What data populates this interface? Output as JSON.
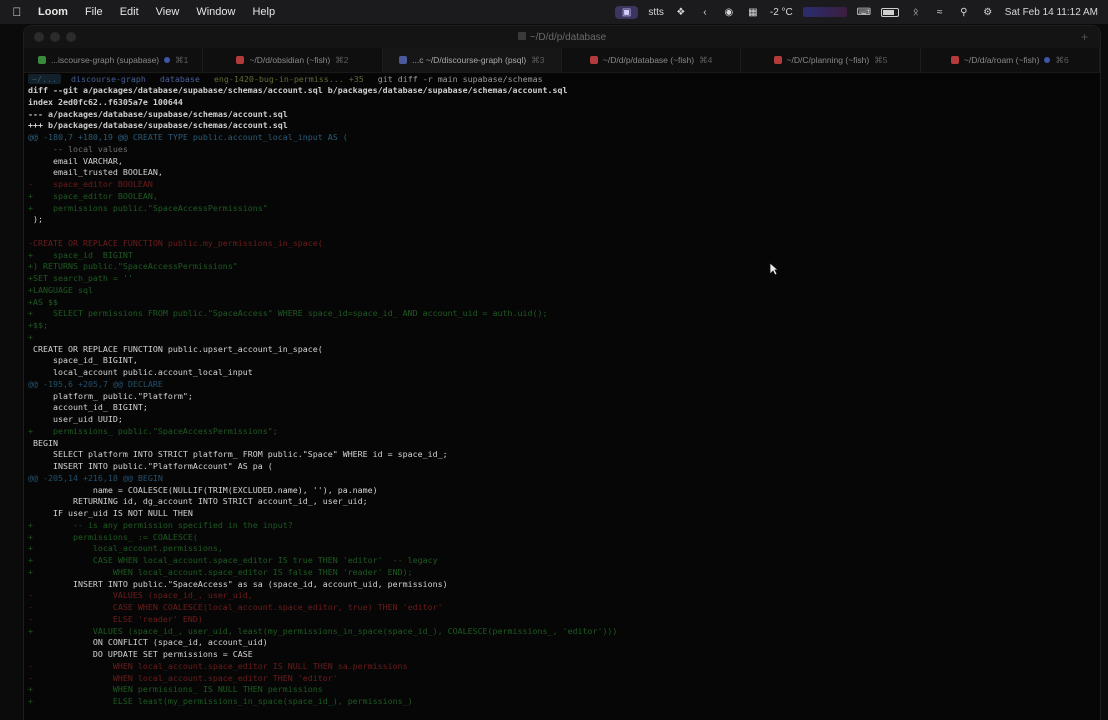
{
  "menubar": {
    "app": "Loom",
    "items": [
      "File",
      "Edit",
      "View",
      "Window",
      "Help"
    ],
    "status": {
      "stts": "stts",
      "weather": "-2 °C",
      "datetime": "Sat Feb 14  11:12 AM"
    }
  },
  "window": {
    "title": "~/D/d/p/database",
    "tabs": [
      {
        "label": "...iscourse-graph (supabase)",
        "shortcut": "⌘1",
        "color": "#3b8a3b",
        "active": false,
        "dot": true
      },
      {
        "label": "~/D/d/obsidian (~fish)",
        "shortcut": "⌘2",
        "color": "#b33b3b",
        "active": false,
        "dot": false
      },
      {
        "label": "...c ~/D/discourse-graph (psql)",
        "shortcut": "⌘3",
        "color": "#4a5a9a",
        "active": true,
        "dot": false
      },
      {
        "label": "~/D/d/p/database (~fish)",
        "shortcut": "⌘4",
        "color": "#b33b3b",
        "active": false,
        "dot": false
      },
      {
        "label": "~/D/C/planning (~fish)",
        "shortcut": "⌘5",
        "color": "#b33b3b",
        "active": false,
        "dot": false
      },
      {
        "label": "~/D/d/a/roam (~fish)",
        "shortcut": "⌘6",
        "color": "#b33b3b",
        "active": false,
        "dot": true
      }
    ]
  },
  "prompt": {
    "dir": "~/...",
    "repo": "discourse-graph",
    "subdir": "database",
    "branch": "eng-1420-bug-in-permiss... +35",
    "command": "git diff -r main supabase/schemas"
  },
  "diff_lines": [
    {
      "type": "hdr",
      "text": "diff --git a/packages/database/supabase/schemas/account.sql b/packages/database/supabase/schemas/account.sql"
    },
    {
      "type": "hdr",
      "text": "index 2ed0fc62..f6305a7e 100644"
    },
    {
      "type": "hdr",
      "text": "--- a/packages/database/supabase/schemas/account.sql"
    },
    {
      "type": "hdr",
      "text": "+++ b/packages/database/supabase/schemas/account.sql"
    },
    {
      "type": "hunk",
      "text": "@@ -180,7 +180,19 @@ CREATE TYPE public.account_local_input AS ("
    },
    {
      "type": "dim",
      "text": "     -- local values"
    },
    {
      "type": "ctx",
      "text": "     email VARCHAR,"
    },
    {
      "type": "ctx",
      "text": "     email_trusted BOOLEAN,"
    },
    {
      "type": "del",
      "text": "-    space_editor BOOLEAN"
    },
    {
      "type": "add",
      "text": "+    space_editor BOOLEAN,"
    },
    {
      "type": "add",
      "text": "+    permissions public.\"SpaceAccessPermissions\""
    },
    {
      "type": "ctx",
      "text": " );"
    },
    {
      "type": "ctx",
      "text": ""
    },
    {
      "type": "del",
      "text": "-CREATE OR REPLACE FUNCTION public.my_permissions_in_space("
    },
    {
      "type": "add",
      "text": "+    space_id  BIGINT"
    },
    {
      "type": "add",
      "text": "+) RETURNS public.\"SpaceAccessPermissions\""
    },
    {
      "type": "add",
      "text": "+SET search_path = ''"
    },
    {
      "type": "add",
      "text": "+LANGUAGE sql"
    },
    {
      "type": "add",
      "text": "+AS $$"
    },
    {
      "type": "add",
      "text": "+    SELECT permissions FROM public.\"SpaceAccess\" WHERE space_id=space_id_ AND account_uid = auth.uid();"
    },
    {
      "type": "add",
      "text": "+$$;"
    },
    {
      "type": "add",
      "text": "+"
    },
    {
      "type": "ctx",
      "text": " CREATE OR REPLACE FUNCTION public.upsert_account_in_space("
    },
    {
      "type": "ctx",
      "text": "     space_id_ BIGINT,"
    },
    {
      "type": "ctx",
      "text": "     local_account public.account_local_input"
    },
    {
      "type": "hunkb",
      "text": "@@ -195,6 +205,7 @@ DECLARE"
    },
    {
      "type": "ctx",
      "text": "     platform_ public.\"Platform\";"
    },
    {
      "type": "ctx",
      "text": "     account_id_ BIGINT;"
    },
    {
      "type": "ctx",
      "text": "     user_uid UUID;"
    },
    {
      "type": "add",
      "text": "+    permissions_ public.\"SpaceAccessPermissions\";"
    },
    {
      "type": "ctx",
      "text": " BEGIN"
    },
    {
      "type": "ctx",
      "text": "     SELECT platform INTO STRICT platform_ FROM public.\"Space\" WHERE id = space_id_;"
    },
    {
      "type": "ctx",
      "text": "     INSERT INTO public.\"PlatformAccount\" AS pa ("
    },
    {
      "type": "hunkb",
      "text": "@@ -205,14 +216,18 @@ BEGIN"
    },
    {
      "type": "ctx",
      "text": "             name = COALESCE(NULLIF(TRIM(EXCLUDED.name), ''), pa.name)"
    },
    {
      "type": "ctx",
      "text": "         RETURNING id, dg_account INTO STRICT account_id_, user_uid;"
    },
    {
      "type": "ctx",
      "text": "     IF user_uid IS NOT NULL THEN"
    },
    {
      "type": "add",
      "text": "+        -- is any permission specified in the input?"
    },
    {
      "type": "add",
      "text": "+        permissions_ := COALESCE("
    },
    {
      "type": "add",
      "text": "+            local_account.permissions,"
    },
    {
      "type": "add",
      "text": "+            CASE WHEN local_account.space_editor IS true THEN 'editor'  -- legacy"
    },
    {
      "type": "add",
      "text": "+                WHEN local_account.space_editor IS false THEN 'reader' END);"
    },
    {
      "type": "ctx",
      "text": "         INSERT INTO public.\"SpaceAccess\" as sa (space_id, account_uid, permissions)"
    },
    {
      "type": "del",
      "text": "-                VALUES (space_id_, user_uid,"
    },
    {
      "type": "del",
      "text": "-                CASE WHEN COALESCE(local_account.space_editor, true) THEN 'editor'"
    },
    {
      "type": "del",
      "text": "-                ELSE 'reader' END)"
    },
    {
      "type": "add",
      "text": "+            VALUES (space_id_, user_uid, least(my_permissions_in_space(space_id_), COALESCE(permissions_, 'editor')))"
    },
    {
      "type": "ctx",
      "text": "             ON CONFLICT (space_id, account_uid)"
    },
    {
      "type": "ctx",
      "text": "             DO UPDATE SET permissions = CASE"
    },
    {
      "type": "del",
      "text": "-                WHEN local_account.space_editor IS NULL THEN sa.permissions"
    },
    {
      "type": "del",
      "text": "-                WHEN local_account.space_editor THEN 'editor'"
    },
    {
      "type": "add",
      "text": "+                WHEN permissions_ IS NULL THEN permissions"
    },
    {
      "type": "add",
      "text": "+                ELSE least(my_permissions_in_space(space_id_), permissions_)"
    }
  ]
}
